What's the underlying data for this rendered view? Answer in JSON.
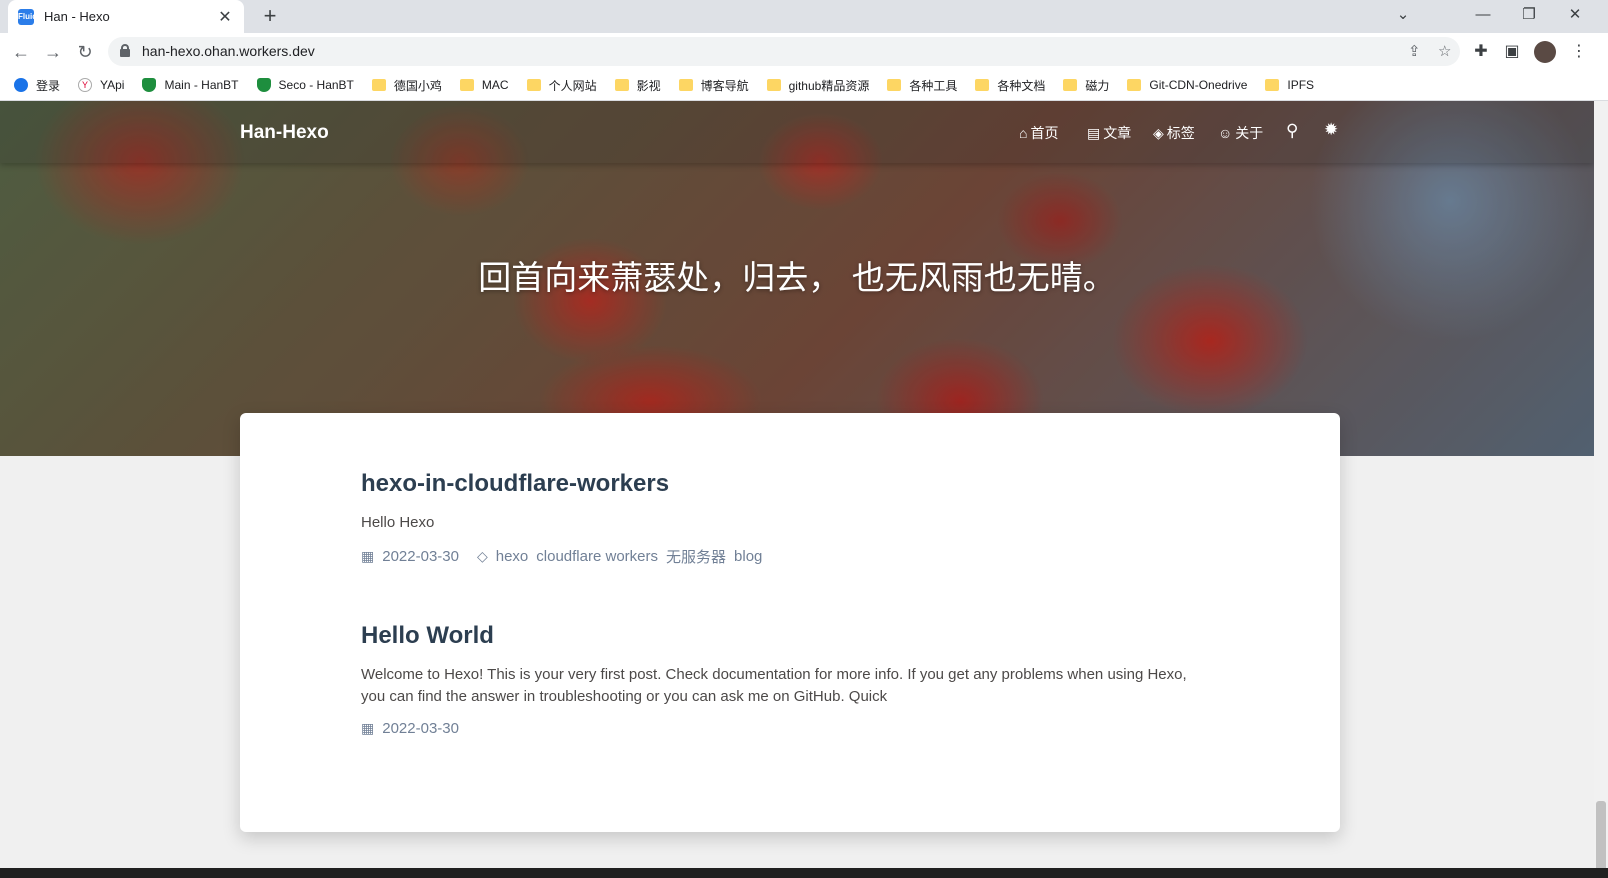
{
  "browser": {
    "tab_title": "Han - Hexo",
    "tab_favicon": "Fluid",
    "url": "han-hexo.ohan.workers.dev",
    "bookmarks": [
      "登录",
      "YApi",
      "Main - HanBT",
      "Seco - HanBT",
      "德国小鸡",
      "MAC",
      "个人网站",
      "影视",
      "博客导航",
      "github精品资源",
      "各种工具",
      "各种文档",
      "磁力",
      "Git-CDN-Onedrive",
      "IPFS"
    ],
    "icons": {
      "back": "←",
      "forward": "→",
      "reload": "↻",
      "new_tab": "+",
      "close_tab": "✕",
      "chevron": "⌄",
      "minimize": "—",
      "restore": "❐",
      "close": "✕",
      "share": "⇪",
      "star": "☆",
      "extensions": "✚",
      "sidepanel": "▣",
      "menu": "⋮"
    }
  },
  "site": {
    "brand": "Han-Hexo",
    "nav": [
      {
        "icon": "⌂",
        "label": "首页"
      },
      {
        "icon": "▤",
        "label": "文章"
      },
      {
        "icon": "◈",
        "label": "标签"
      },
      {
        "icon": "☺",
        "label": "关于"
      }
    ],
    "search_icon": "⚲",
    "theme_icon": "✹",
    "slogan": "回首向来萧瑟处，归去，  也无风雨也无晴。"
  },
  "posts": [
    {
      "title": "hexo-in-cloudflare-workers",
      "excerpt": "Hello Hexo",
      "date": "2022-03-30",
      "tags": [
        "hexo",
        "cloudflare workers",
        "无服务器",
        "blog"
      ]
    },
    {
      "title": "Hello World",
      "excerpt": "Welcome to Hexo! This is your very first post. Check documentation for more info. If you get any problems when using Hexo, you can find the answer in troubleshooting or you can ask me on GitHub. Quick",
      "date": "2022-03-30"
    }
  ],
  "meta_icons": {
    "calendar": "▦",
    "tag": "◇"
  }
}
